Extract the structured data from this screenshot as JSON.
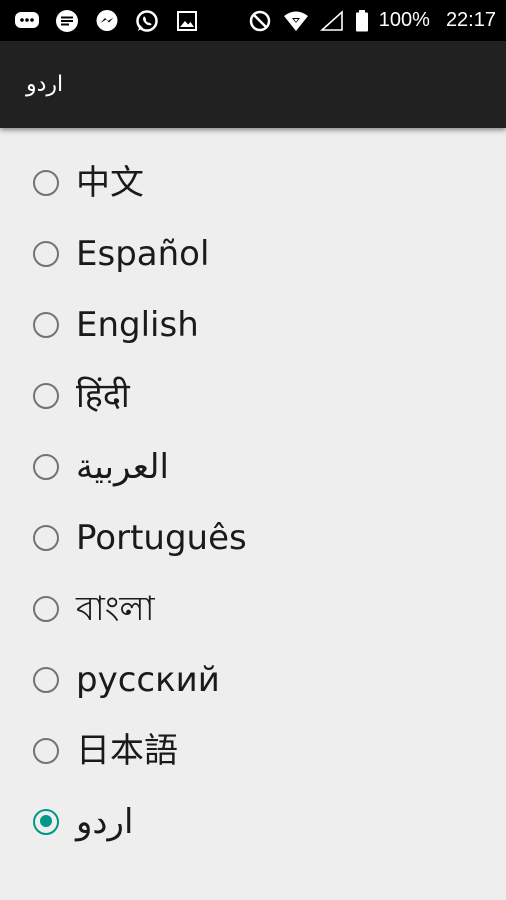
{
  "status_bar": {
    "battery_text": "100%",
    "time": "22:17",
    "icons": [
      "chat-bubble-icon",
      "sms-icon",
      "messenger-icon",
      "whatsapp-icon",
      "image-icon",
      "do-not-disturb-icon",
      "wifi-icon",
      "signal-icon",
      "battery-icon"
    ]
  },
  "app_bar": {
    "title": "اردو"
  },
  "languages": [
    {
      "label": "中文",
      "checked": false
    },
    {
      "label": "Español",
      "checked": false
    },
    {
      "label": "English",
      "checked": false
    },
    {
      "label": "हिंदी",
      "checked": false
    },
    {
      "label": "العربية",
      "checked": false
    },
    {
      "label": "Português",
      "checked": false
    },
    {
      "label": "বাংলা",
      "checked": false
    },
    {
      "label": "русский",
      "checked": false
    },
    {
      "label": "日本語",
      "checked": false
    },
    {
      "label": "اردو",
      "checked": true
    }
  ],
  "colors": {
    "accent": "#009688",
    "status_bar": "#000000",
    "app_bar": "#212121",
    "background": "#eeeeee"
  }
}
